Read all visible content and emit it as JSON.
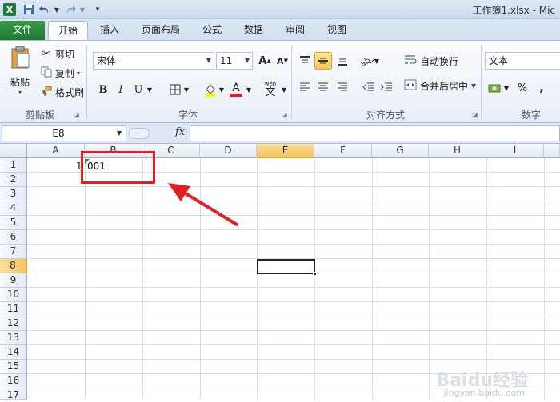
{
  "window": {
    "title": "工作簿1.xlsx - Mic"
  },
  "tabs": {
    "file": "文件",
    "items": [
      "开始",
      "插入",
      "页面布局",
      "公式",
      "数据",
      "审阅",
      "视图"
    ]
  },
  "clipboard": {
    "paste": "粘贴",
    "cut": "剪切",
    "copy": "复制",
    "format_painter": "格式刷",
    "label": "剪贴板"
  },
  "font": {
    "name": "宋体",
    "size": "11",
    "label": "字体"
  },
  "alignment": {
    "wrap_text": "自动换行",
    "merge_center": "合并后居中",
    "label": "对齐方式"
  },
  "number": {
    "format": "文本",
    "label": "数字"
  },
  "formula_bar": {
    "name_box": "E8",
    "fx": "fx",
    "content": ""
  },
  "grid": {
    "columns": [
      "A",
      "B",
      "C",
      "D",
      "E",
      "F",
      "G",
      "H",
      "I"
    ],
    "rows": [
      "1",
      "2",
      "3",
      "4",
      "5",
      "6",
      "7",
      "8",
      "9",
      "10",
      "11",
      "12",
      "13",
      "14",
      "15",
      "16",
      "17"
    ],
    "selected_column": "E",
    "selected_row": "8",
    "cells": {
      "A1_overflow": "1",
      "B1": "001"
    }
  },
  "watermark": {
    "text": "Baidu经验",
    "url": "jingyan.baidu.com"
  },
  "colors": {
    "file_tab": "#1f7a31",
    "highlight_fill": "#ffff00",
    "font_color": "#e02020",
    "annotation": "#e02020",
    "selection_header": "#f4c461"
  }
}
